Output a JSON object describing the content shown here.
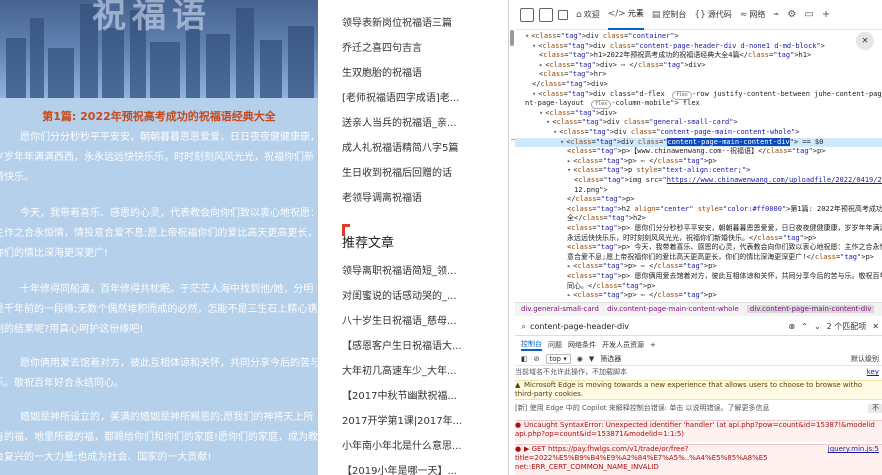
{
  "article": {
    "hero_text": "祝福语",
    "heading": "第1篇: 2022年预祝高考成功的祝福语经典大全",
    "paragraphs": [
      "愿你们分分秒秒平平安安，朝朝暮暮恩恩爱爱，日日夜夜健健康康，岁岁年年满满西西，永永远远快快乐乐，时时刻刻风风光光，祝福你们新婚快乐。",
      "今天，我带着喜乐、感恩的心灵，代表教会向你们致以衷心地祝愿：主作之合永恒情，情投意合爱不息;愿上帝祝福你们的爱比高天更高更长，你们的情比深海更深更广!",
      "十年修得同船渡，百年修得共枕眠。于茫茫人海中找到他/她，分明是千年前的一段缘;无数个偶然堆积而成的必然，怎能不是三生石上精心镌刻的结果呢?用真心呵护这份缘吧!",
      "愿你俩用爱去馆着对方，彼此互相体谅和关怀，共同分享今后的苦与乐。敬祝百年好合永结同心。",
      "婚姻是神所设立的，美满的婚姻是神所赐恩的;愿我们的神将天上所有的福、地里所藏的福，都赐给你们和你们的家庭!愿你们的家庭，成为教会复兴的一大力量;也成为社会、国家的一大贡献!"
    ]
  },
  "sidebar": {
    "top_links": [
      "领导表新岗位祝福语三篇",
      "乔迁之喜四句吉言",
      "生双胞胎的祝福语",
      "[老师祝福语四字成语]老...",
      "送亲人当兵的祝福语_亲...",
      "成人礼祝福语精简八字5篇",
      "生日收到祝福后回赠的话",
      "老领导调离祝福语"
    ],
    "recommend_title": "推荐文章",
    "recommend_links": [
      "领导离职祝福语简短_领...",
      "对闺蜜说的话感动哭的_...",
      "八十岁生日祝福语_慈母...",
      "【感恩客户生日祝福语大...",
      "大年初几高速车少_大年...",
      "【2017中秋节幽默祝福...",
      "2017开学第1课|2017年...",
      "小年南小年北是什么意思...",
      "【2019小年是哪一天】..."
    ]
  },
  "devtools": {
    "toolbar": {
      "tabs": [
        {
          "glyph": "⌂",
          "label": "欢迎"
        },
        {
          "glyph": "</>",
          "label": "元素"
        },
        {
          "glyph": "▤",
          "label": "控制台"
        },
        {
          "glyph": "{}",
          "label": "源代码"
        },
        {
          "glyph": "≈",
          "label": "网络"
        }
      ],
      "more": "+"
    },
    "elements": {
      "lines": [
        {
          "indent": 0,
          "tri": "▾",
          "html": "<div class=\"container\">"
        },
        {
          "indent": 1,
          "tri": "▾",
          "html": "<div class=\"content-page-header-div d-none1 d-md-block\">"
        },
        {
          "indent": 2,
          "tri": "",
          "html": "<h1>2022年预祝高考成功的祝福语经典大全4篇</h1>"
        },
        {
          "indent": 2,
          "tri": "▸",
          "html": "<div> ⋯ </div>"
        },
        {
          "indent": 2,
          "tri": "",
          "html": "<hr>"
        },
        {
          "indent": 1,
          "tri": "",
          "html": "</div>"
        },
        {
          "indent": 1,
          "tri": "▾",
          "html": "<div class=\"d-flex flex-row justify-content-between juhe-content-page-top-margin conte"
        },
        {
          "indent": 0,
          "tri": "",
          "html": "nt-page-layout flex-column-mobile\"> flex"
        },
        {
          "indent": 2,
          "tri": "▾",
          "html": "<div>"
        },
        {
          "indent": 3,
          "tri": "▾",
          "html": "<div class=\"general-small-card\">"
        },
        {
          "indent": 4,
          "tri": "▾",
          "html": "<div class=\"content-page-main-content-whole\">"
        },
        {
          "indent": 5,
          "tri": "▾",
          "html": "<div class=\"content-page-main-content-div\"> == $0"
        },
        {
          "indent": 6,
          "tri": "",
          "html": "<p>【www.chinawenwang.com--祝福语】</p>"
        },
        {
          "indent": 6,
          "tri": "▸",
          "html": "<p> ⋯ </p>"
        },
        {
          "indent": 6,
          "tri": "▾",
          "html": "<p style=\"text-align:center;\">"
        },
        {
          "indent": 7,
          "tri": "",
          "html": "<img src=\"https://www.chinawenwang.com/uploadfile/2022/0419/202204190458469"
        },
        {
          "indent": 7,
          "tri": "",
          "html": "12.png\">"
        },
        {
          "indent": 6,
          "tri": "",
          "html": "</p>"
        },
        {
          "indent": 6,
          "tri": "",
          "html": "<h2 align=\"center\" style=\"color:#ff0000\">第1篇: 2022年预祝高考成功的祝福语经典大"
        },
        {
          "indent": 6,
          "tri": "",
          "html": "全</h2>"
        },
        {
          "indent": 6,
          "tri": "",
          "html": "<p> 愿你们分分秒秒平平安安，朝朝暮暮恩恩爱爱，日日夜夜健健康康，岁岁年年满满西西，永"
        },
        {
          "indent": 6,
          "tri": "",
          "html": "永远远快快乐乐，时时刻刻风风光光，祝福你们新婚快乐。</p>"
        },
        {
          "indent": 6,
          "tri": "",
          "html": "<p> 今天，我带着喜乐、感恩的心灵，代表教会向你们致以衷心地祝愿：主作之合永恒情，情投"
        },
        {
          "indent": 6,
          "tri": "",
          "html": "意合爱不息;愿上帝祝福你们的爱比高天更高更长，你们的情比深海更深更广!</p>"
        },
        {
          "indent": 6,
          "tri": "▸",
          "html": "<p> ⋯ </p>"
        },
        {
          "indent": 6,
          "tri": "",
          "html": "<p> 愿你俩用爱去馆着对方，彼此互相体谅和关怀，共同分享今后的苦与乐。敬祝百年好合永结"
        },
        {
          "indent": 6,
          "tri": "",
          "html": "同心。</p>"
        },
        {
          "indent": 6,
          "tri": "▸",
          "html": "<p> ⋯ </p>"
        }
      ],
      "selected_class": "content-page-main-content-div",
      "flex_badge": "flex",
      "dollar_zero": "== $0"
    },
    "breadcrumb": [
      "div.general-small-card",
      "div.content-page-main-content-whole",
      "div.content-page-main-content-div"
    ],
    "search": {
      "value": "content-page-header-div",
      "match_count": "2 个匹配项"
    },
    "console": {
      "tabs": [
        "控制台",
        "问题",
        "网络条件",
        "开发人员资源",
        "+"
      ],
      "context": "top ▾",
      "filter_placeholder": "筛选器",
      "level": "默认级别",
      "messages": [
        {
          "type": "plain",
          "text": "当前域名不允许此操作，不加载脚本",
          "src": "key"
        },
        {
          "type": "warn",
          "text": "Microsoft Edge is moving towards a new experience that allows users to choose to browse witho third-party cookies.",
          "src": ""
        },
        {
          "type": "plain",
          "text": "[新] 使用 Edge 中的 Copilot 来解释控制台错误: 单击 以说明错误。了解更多信息",
          "src": ""
        },
        {
          "type": "err",
          "text": "Uncaught SyntaxError: Unexpected identifier 'handler' (at api.php?pow=count&id=15387!&modelid api.php?op=count&id=153871&modelid=1:1:5)",
          "src": ""
        },
        {
          "type": "err",
          "text": "▶ GET https://pay.fhwlgs.com/v1/trade/or/free?title=2022%E5%B9%B4%E9%A2%84%E7%A5%..%A4%E5%85%A8%E5 net::ERR_CERT_COMMON_NAME_INVALID",
          "src": "jquery.min.js:5"
        }
      ],
      "copilot_button": "不"
    }
  },
  "colors": {
    "article_bg": "#b4d0ea",
    "heading": "#c8491d",
    "accent": "#0c61c9",
    "selection": "#0c4cbf"
  }
}
